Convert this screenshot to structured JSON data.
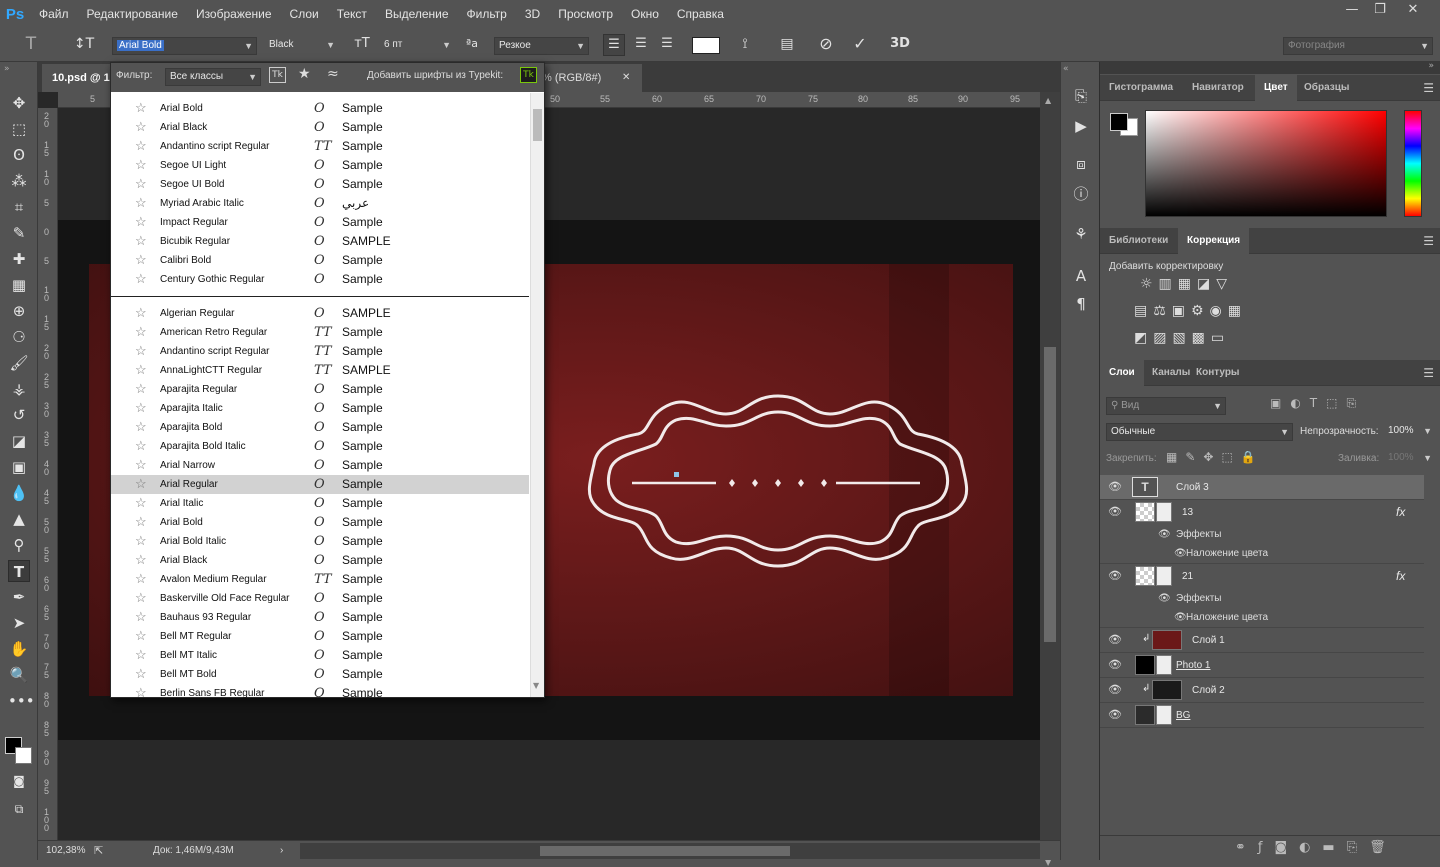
{
  "menubar": {
    "logo": "Ps",
    "items": [
      "Файл",
      "Редактирование",
      "Изображение",
      "Слои",
      "Текст",
      "Выделение",
      "Фильтр",
      "3D",
      "Просмотр",
      "Окно",
      "Справка"
    ],
    "window_buttons": [
      "—",
      "❐",
      "✕"
    ]
  },
  "options": {
    "font_family": "Arial Bold",
    "font_style": "Black",
    "font_size": "6 пт",
    "antialias": "Резкое",
    "workspace": "Фотография",
    "color_swatch": "#ffffff"
  },
  "document": {
    "tab_title": "10.psd @ 1",
    "tab_title_suffix": "% (RGB/8#)",
    "close_glyph": "✕",
    "ruler_h": [
      "5",
      "50",
      "55",
      "60",
      "65",
      "70",
      "75",
      "80",
      "85",
      "90",
      "95"
    ],
    "ruler_v": [
      "2 0",
      "1 5",
      "1 0",
      "5",
      "0",
      "5",
      "1 0",
      "1 5",
      "2 0",
      "2 5",
      "3 0",
      "3 5",
      "4 0",
      "4 5",
      "5 0",
      "5 5",
      "6 0",
      "6 5",
      "7 0",
      "7 5",
      "8 0",
      "8 5",
      "9 0",
      "9 5",
      "1 0 0"
    ]
  },
  "font_menu": {
    "filter_label": "Фильтр:",
    "filter_value": "Все классы",
    "tk_badge": "Tk",
    "typekit_label": "Добавить шрифты из Typekit:",
    "recent": [
      {
        "name": "Arial Bold",
        "type": "O",
        "sample": "Sample"
      },
      {
        "name": "Arial Black",
        "type": "O",
        "sample": "Sample"
      },
      {
        "name": "Andantino script Regular",
        "type": "TT",
        "sample": "Sample"
      },
      {
        "name": "Segoe UI Light",
        "type": "O",
        "sample": "Sample"
      },
      {
        "name": "Segoe UI Bold",
        "type": "O",
        "sample": "Sample"
      },
      {
        "name": "Myriad Arabic Italic",
        "type": "O",
        "sample": "عربي"
      },
      {
        "name": "Impact Regular",
        "type": "O",
        "sample": "Sample"
      },
      {
        "name": "Bicubik Regular",
        "type": "O",
        "sample": "SAMPLE"
      },
      {
        "name": "Calibri Bold",
        "type": "O",
        "sample": "Sample"
      },
      {
        "name": "Century Gothic Regular",
        "type": "O",
        "sample": "Sample"
      }
    ],
    "all": [
      {
        "name": "Algerian Regular",
        "type": "O",
        "sample": "SAMPLE"
      },
      {
        "name": "American Retro Regular",
        "type": "TT",
        "sample": "Sample"
      },
      {
        "name": "Andantino script Regular",
        "type": "TT",
        "sample": "Sample"
      },
      {
        "name": "AnnaLightCTT Regular",
        "type": "TT",
        "sample": "SAMPLE"
      },
      {
        "name": "Aparajita Regular",
        "type": "O",
        "sample": "Sample"
      },
      {
        "name": "Aparajita Italic",
        "type": "O",
        "sample": "Sample"
      },
      {
        "name": "Aparajita Bold",
        "type": "O",
        "sample": "Sample"
      },
      {
        "name": "Aparajita Bold Italic",
        "type": "O",
        "sample": "Sample"
      },
      {
        "name": "Arial Narrow",
        "type": "O",
        "sample": "Sample"
      },
      {
        "name": "Arial Regular",
        "type": "O",
        "sample": "Sample"
      },
      {
        "name": "Arial Italic",
        "type": "O",
        "sample": "Sample"
      },
      {
        "name": "Arial Bold",
        "type": "O",
        "sample": "Sample"
      },
      {
        "name": "Arial Bold Italic",
        "type": "O",
        "sample": "Sample"
      },
      {
        "name": "Arial Black",
        "type": "O",
        "sample": "Sample"
      },
      {
        "name": "Avalon Medium Regular",
        "type": "TT",
        "sample": "Sample"
      },
      {
        "name": "Baskerville Old Face Regular",
        "type": "O",
        "sample": "Sample"
      },
      {
        "name": "Bauhaus 93 Regular",
        "type": "O",
        "sample": "Sample"
      },
      {
        "name": "Bell MT Regular",
        "type": "O",
        "sample": "Sample"
      },
      {
        "name": "Bell MT Italic",
        "type": "O",
        "sample": "Sample"
      },
      {
        "name": "Bell MT Bold",
        "type": "O",
        "sample": "Sample"
      },
      {
        "name": "Berlin Sans FB Regular",
        "type": "O",
        "sample": "Sample"
      }
    ],
    "highlighted": "Arial Regular"
  },
  "panels": {
    "top_tabs": [
      "Гистограмма",
      "Навигатор",
      "Цвет",
      "Образцы"
    ],
    "top_active": "Цвет",
    "mid_tabs": [
      "Библиотеки",
      "Коррекция"
    ],
    "mid_active": "Коррекция",
    "adjust_title": "Добавить корректировку",
    "layer_tabs": [
      "Слои",
      "Каналы",
      "Контуры"
    ],
    "layer_active": "Слои",
    "kind_search": "Вид",
    "blend_mode": "Обычные",
    "opacity_label": "Непрозрачность:",
    "opacity_value": "100%",
    "lock_label": "Закрепить:",
    "fill_label": "Заливка:",
    "fill_value": "100%",
    "layers": [
      {
        "name": "Слой 3",
        "kind": "text"
      },
      {
        "name": "13",
        "kind": "smart",
        "fx": true
      },
      {
        "name": "21",
        "kind": "smart",
        "fx": true
      },
      {
        "name": "Слой 1",
        "kind": "clip"
      },
      {
        "name": "Photo 1",
        "kind": "smart"
      },
      {
        "name": "Слой 2",
        "kind": "clip"
      },
      {
        "name": "BG",
        "kind": "smart"
      }
    ],
    "effects_label": "Эффекты",
    "effect_name": "Наложение цвета",
    "fx_label": "fx"
  },
  "status": {
    "zoom": "102,38%",
    "doc": "Док: 1,46M/9,43M"
  }
}
